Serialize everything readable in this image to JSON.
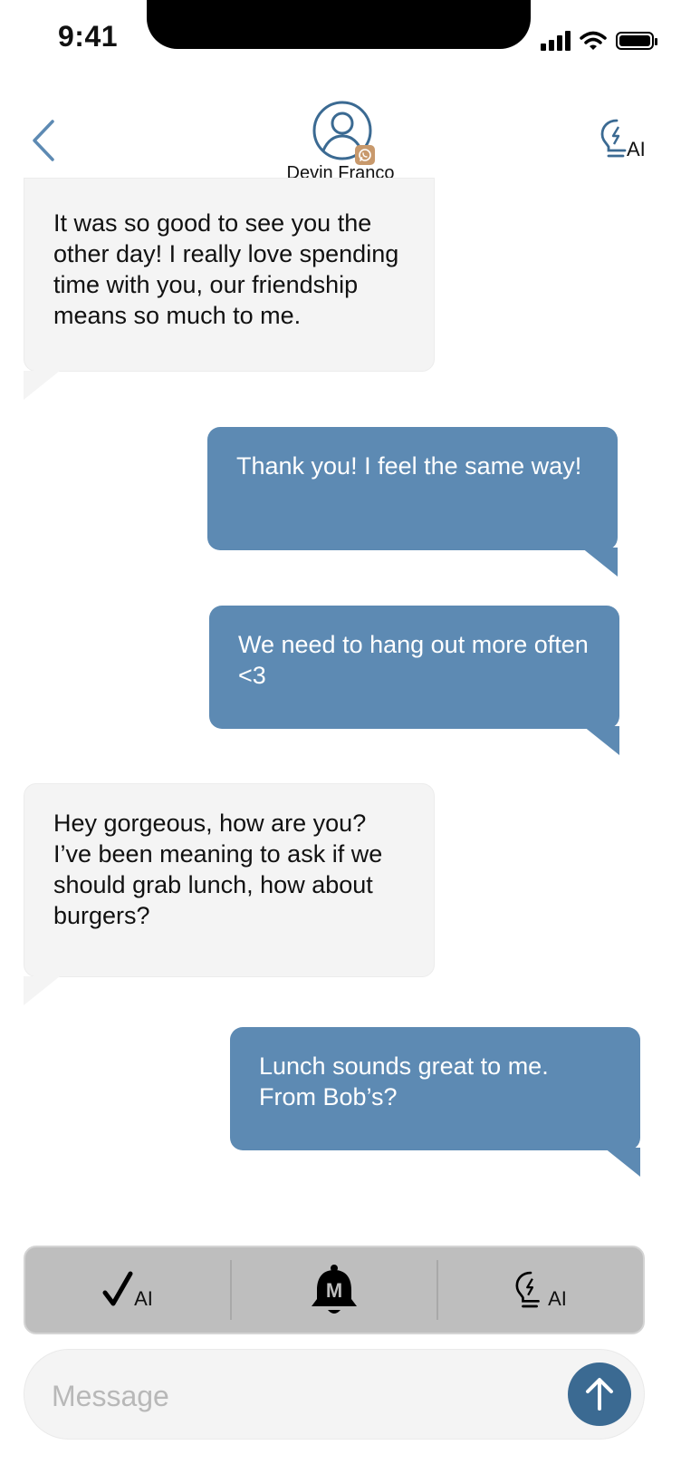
{
  "status_bar": {
    "time": "9:41",
    "icons": [
      "signal-icon",
      "wifi-icon",
      "battery-icon"
    ]
  },
  "header": {
    "contact_name": "Devin Franco",
    "avatar_icon": "user-avatar-icon",
    "badge_icon": "whatsapp-icon",
    "back_icon": "chevron-left-icon",
    "ai_icon": "lightbulb-ai-icon",
    "ai_label": "AI"
  },
  "messages": [
    {
      "direction": "incoming",
      "text": "It was so good to see you the other day! I really love spending time with you, our friendship means so much to me."
    },
    {
      "direction": "outgoing",
      "text": "Thank you! I feel the same way!"
    },
    {
      "direction": "outgoing",
      "text": "We need to hang out more often <3"
    },
    {
      "direction": "incoming",
      "text": "Hey gorgeous, how are you? I’ve been meaning to ask if we should grab lunch, how about burgers?"
    },
    {
      "direction": "outgoing",
      "text": "Lunch sounds great to me. From Bob’s?"
    }
  ],
  "toolbar": {
    "buttons": [
      {
        "icon": "checkmark-ai-icon",
        "label": "AI"
      },
      {
        "icon": "bell-icon",
        "label": "M"
      },
      {
        "icon": "lightbulb-ai-icon",
        "label": "AI"
      }
    ]
  },
  "composer": {
    "placeholder": "Message",
    "value": "",
    "send_icon": "arrow-up-icon"
  },
  "colors": {
    "accent": "#3b6a92",
    "outgoing_bubble": "#5d8ab3",
    "incoming_bubble": "#f4f4f4",
    "toolbar_bg": "#bebebe",
    "badge": "#c8996c"
  }
}
